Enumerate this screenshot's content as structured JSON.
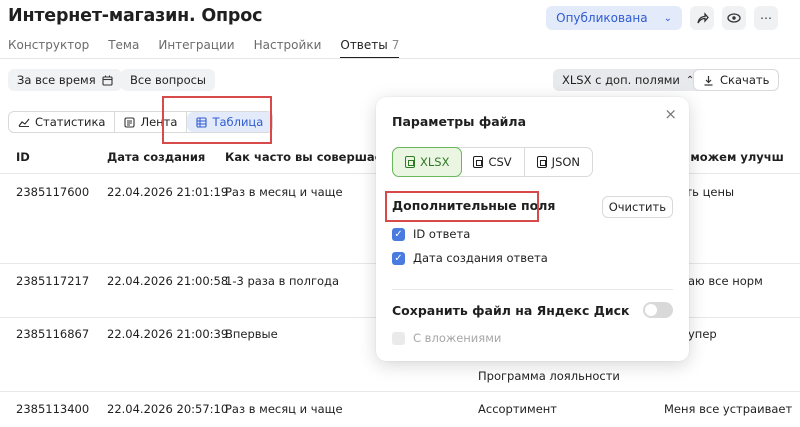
{
  "header": {
    "title": "Интернет-магазин. Опрос",
    "publish_label": "Опубликована",
    "icons": [
      "share-icon",
      "eye-icon",
      "more-icon"
    ]
  },
  "tabs": [
    {
      "label": "Конструктор"
    },
    {
      "label": "Тема"
    },
    {
      "label": "Интеграции"
    },
    {
      "label": "Настройки"
    },
    {
      "label": "Ответы",
      "count": "7",
      "active": true
    }
  ],
  "filters": {
    "period_label": "За все время",
    "questions_label": "Все вопросы",
    "export_format_label": "XLSX с доп. полями",
    "download_label": "Скачать"
  },
  "views": [
    {
      "label": "Статистика",
      "icon": "chart-icon"
    },
    {
      "label": "Лента",
      "icon": "feed-icon"
    },
    {
      "label": "Таблица",
      "icon": "table-icon",
      "active": true
    }
  ],
  "table": {
    "columns": [
      "ID",
      "Дата создания",
      "Как часто вы совершаете по",
      "ы можем улучш"
    ],
    "rows": [
      {
        "id": "2385117600",
        "date": "22.04.2026 21:01:19",
        "freq": "Раз в месяц и чаще",
        "right": "ить цены"
      },
      {
        "id": "2385117217",
        "date": "22.04.2026 21:00:58",
        "freq": "1-3 раза в полгода",
        "right": "аю все норм"
      },
      {
        "id": "2385116867",
        "date": "22.04.2026 21:00:39",
        "freq": "Впервые",
        "right": "упер",
        "extra": "Программа лояльности"
      },
      {
        "id": "2385113400",
        "date": "22.04.2026 20:57:10",
        "freq": "Раз в месяц и чаще",
        "mid": "Ассортимент",
        "right": "Меня все устраивает"
      }
    ]
  },
  "popup": {
    "title": "Параметры файла",
    "formats": [
      "XLSX",
      "CSV",
      "JSON"
    ],
    "selected_format": "XLSX",
    "extra_fields_title": "Дополнительные поля",
    "clear_label": "Очистить",
    "fields": [
      {
        "label": "ID ответа",
        "checked": true
      },
      {
        "label": "Дата создания ответа",
        "checked": true
      }
    ],
    "disk_label": "Сохранить файл на Яндекс Диск",
    "disk_enabled": false,
    "attachments_label": "С вложениями",
    "attachments_enabled": false
  },
  "colors": {
    "accent": "#2f5bd1",
    "highlight_box": "#d84a4a",
    "xlsx_green": "#2f7a24"
  }
}
